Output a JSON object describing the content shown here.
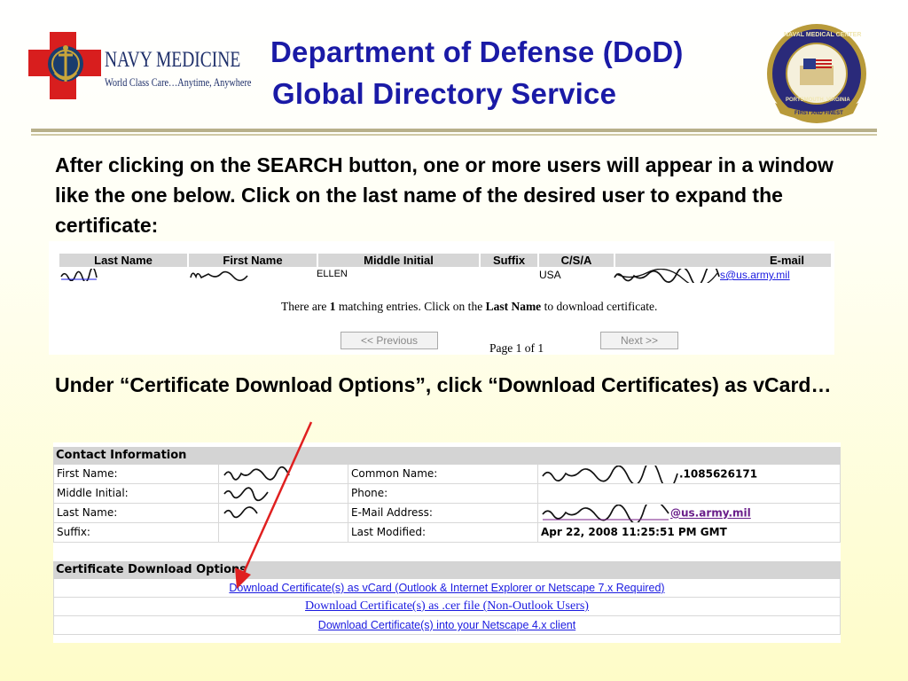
{
  "header": {
    "logo_name": "NAVY MEDICINE",
    "logo_tagline": "World Class Care…Anytime, Anywhere",
    "title_line1": "Department of Defense (DoD)",
    "title_line2": "Global Directory Service",
    "seal_text_top": "NAVAL MEDICAL CENTER",
    "seal_text_bottom": "PORTSMOUTH, VIRGINIA",
    "seal_banner": "FIRST AND FINEST"
  },
  "instructions": {
    "step1": "After clicking on the SEARCH button, one or more users will appear in a window like the one below.  Click on the last name of the desired user to expand the certificate:",
    "step2": "Under “Certificate Download Options”, click “Download Certificates) as vCard…"
  },
  "results": {
    "columns": [
      "Last Name",
      "First Name",
      "Middle Initial",
      "Suffix",
      "C/S/A",
      "E-mail"
    ],
    "row": {
      "middle_initial": "ELLEN",
      "csa": "USA",
      "email_suffix": "s@us.army.mil"
    },
    "message_prefix": "There are ",
    "message_count": "1",
    "message_mid": " matching entries. Click on the ",
    "message_bold": "Last Name",
    "message_suffix": " to download certificate.",
    "prev_label": "<< Previous",
    "next_label": "Next >>",
    "page_indicator": "Page 1 of 1"
  },
  "contact": {
    "section_title": "Contact Information",
    "labels": {
      "first_name": "First Name:",
      "middle_initial": "Middle Initial:",
      "last_name": "Last Name:",
      "suffix": "Suffix:",
      "common_name": "Common Name:",
      "phone": "Phone:",
      "email": "E-Mail Address:",
      "last_modified": "Last Modified:"
    },
    "values": {
      "common_name_suffix": ".1085626171",
      "email_suffix": "@us.army.mil",
      "last_modified": "Apr 22, 2008 11:25:51 PM GMT"
    }
  },
  "downloads": {
    "section_title": "Certificate Download Options",
    "vcard": "Download Certificate(s) as vCard (Outlook & Internet Explorer or Netscape 7.x Required)",
    "cer": "Download Certificate(s) as .cer file (Non-Outlook Users)",
    "netscape": "Download Certificate(s) into your Netscape 4.x client"
  },
  "colors": {
    "title": "#1a1aa6",
    "link": "#1a1ae0",
    "arrow": "#e02020",
    "section_bg": "#d4d4d4"
  }
}
